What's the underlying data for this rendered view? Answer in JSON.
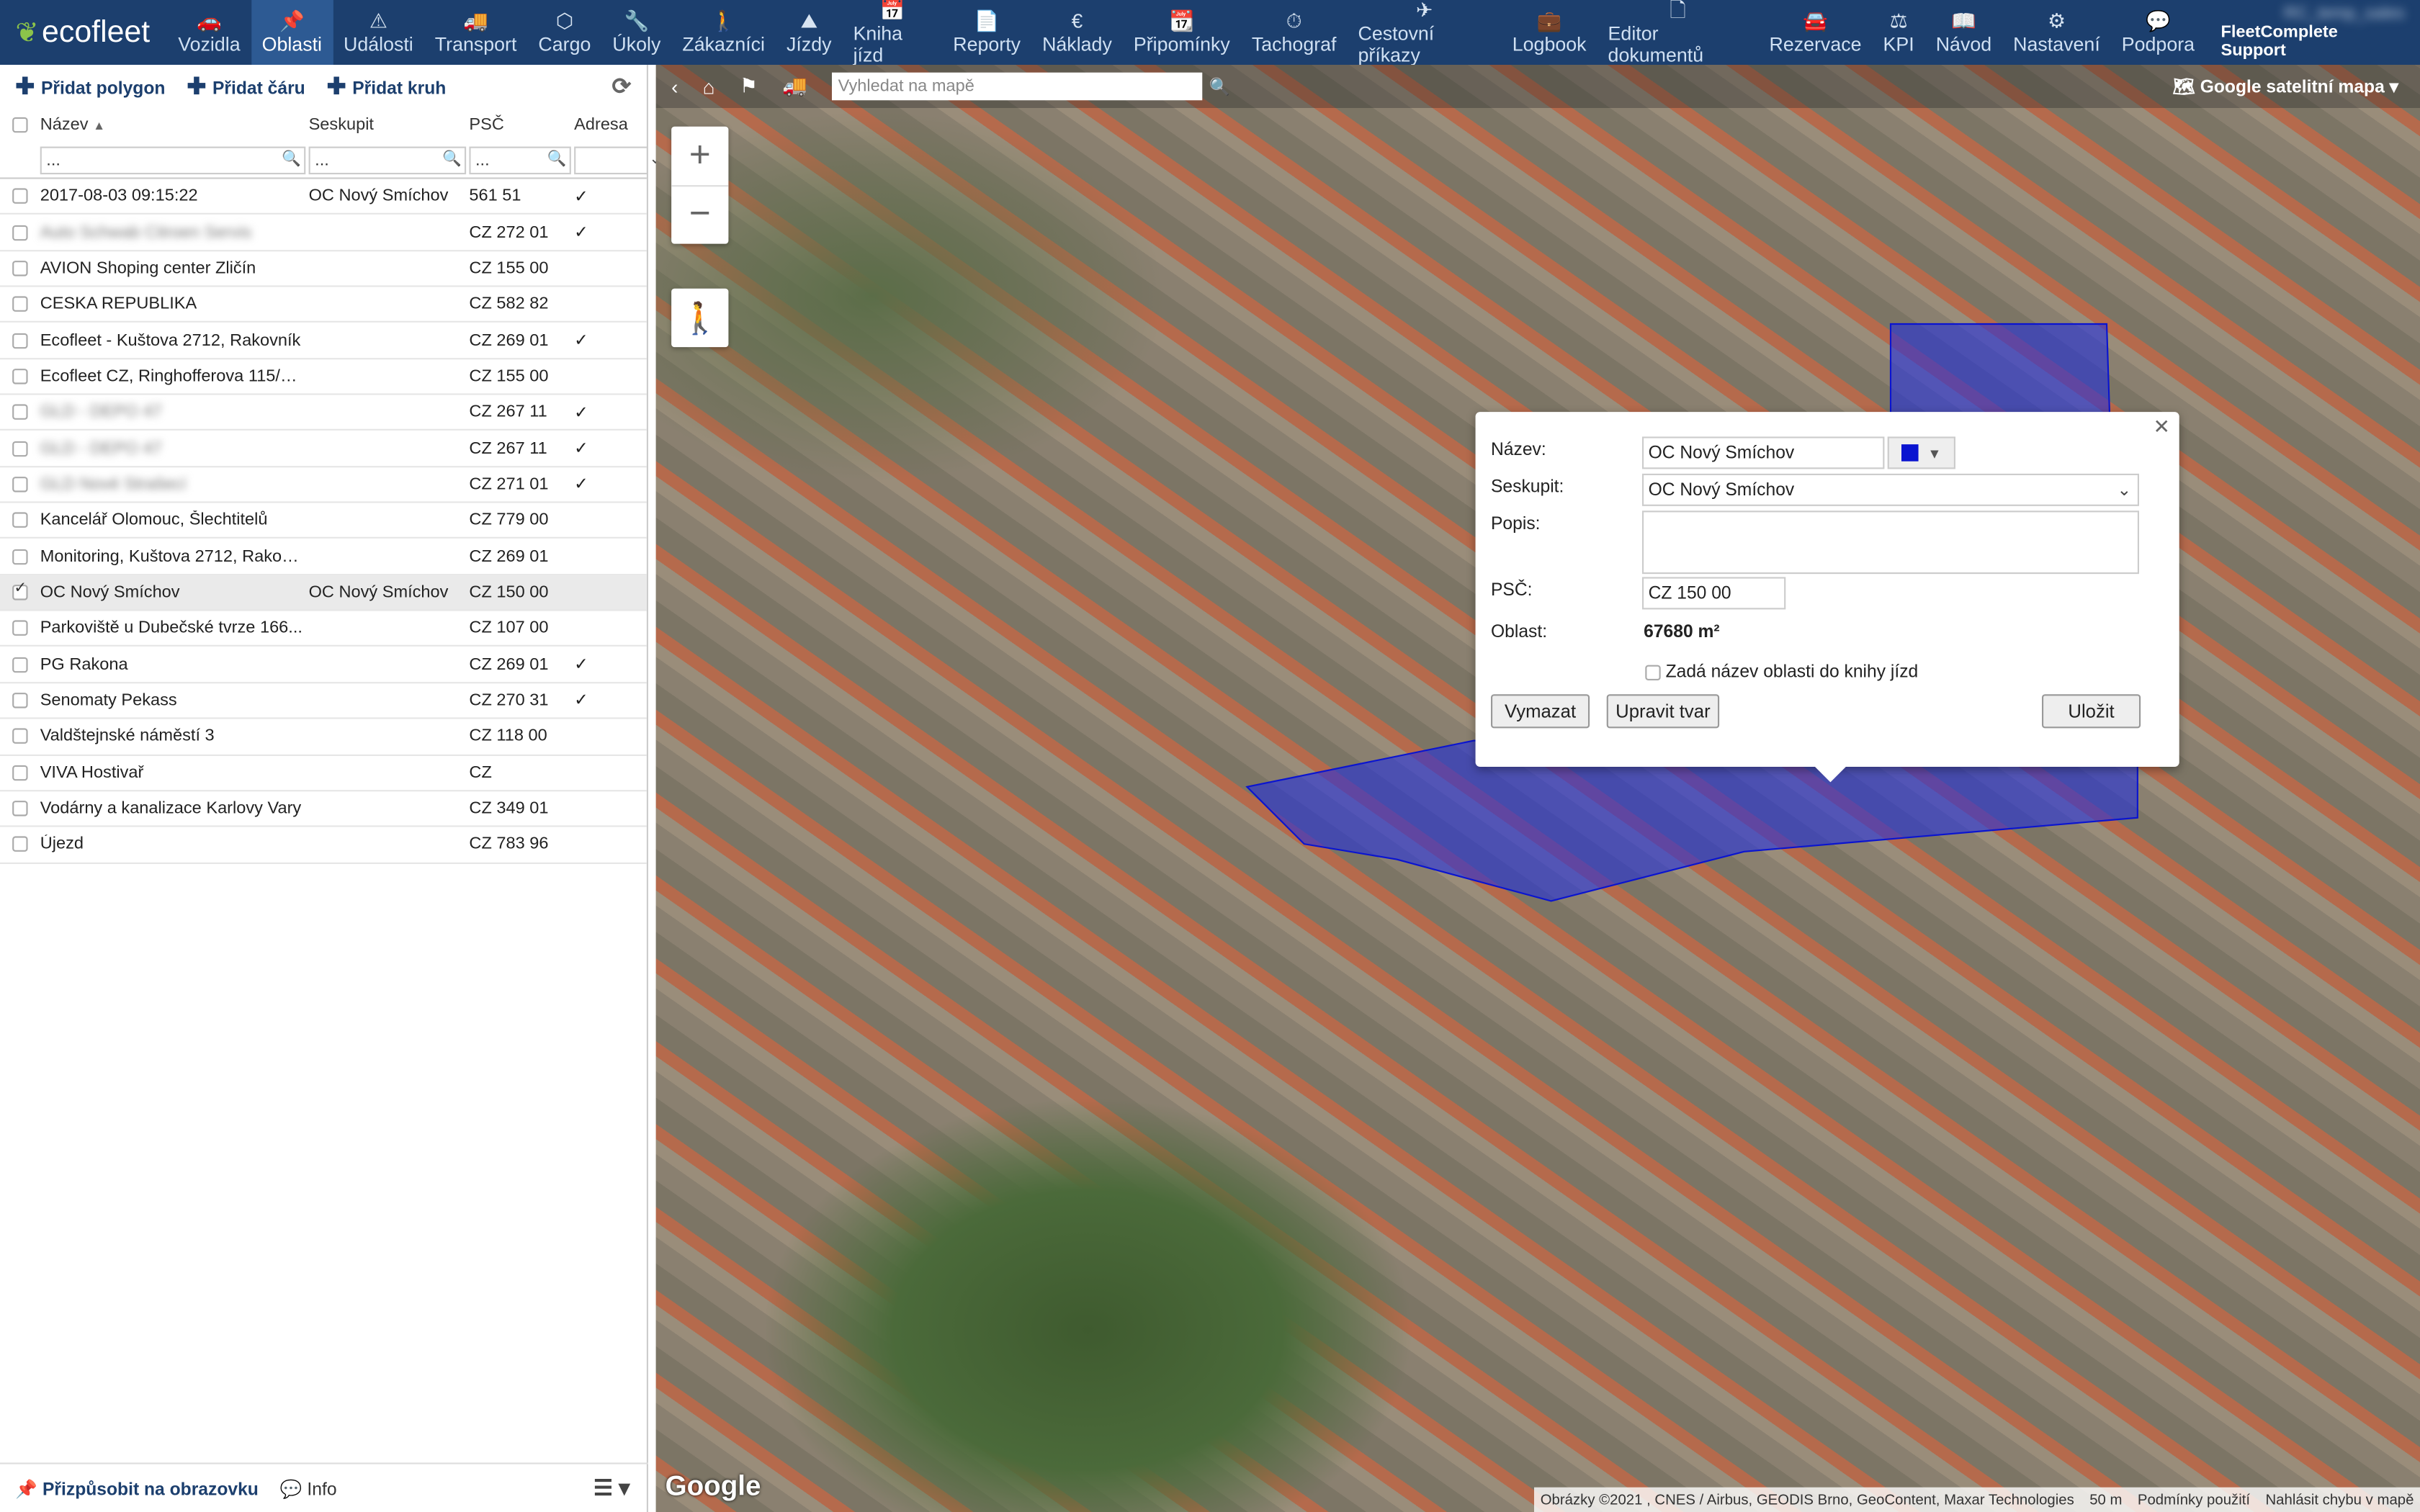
{
  "nav": {
    "brand": "ecofleet",
    "items": [
      {
        "icon": "car-icon",
        "glyph": "🚗",
        "label": "Vozidla"
      },
      {
        "icon": "pin-icon",
        "glyph": "📌",
        "label": "Oblasti"
      },
      {
        "icon": "warning-icon",
        "glyph": "⚠",
        "label": "Události"
      },
      {
        "icon": "truck-icon",
        "glyph": "🚚",
        "label": "Transport"
      },
      {
        "icon": "box-icon",
        "glyph": "⬡",
        "label": "Cargo"
      },
      {
        "icon": "wrench-icon",
        "glyph": "🔧",
        "label": "Úkoly"
      },
      {
        "icon": "person-icon",
        "glyph": "🚶",
        "label": "Zákazníci"
      },
      {
        "icon": "road-icon",
        "glyph": "⛰",
        "label": "Jízdy"
      },
      {
        "icon": "calendar-icon",
        "glyph": "📅",
        "label": "Kniha jízd"
      },
      {
        "icon": "document-icon",
        "glyph": "📄",
        "label": "Reporty"
      },
      {
        "icon": "euro-icon",
        "glyph": "€",
        "label": "Náklady"
      },
      {
        "icon": "calendar-check-icon",
        "glyph": "📆",
        "label": "Připomínky"
      },
      {
        "icon": "gauge-icon",
        "glyph": "⏱",
        "label": "Tachograf"
      },
      {
        "icon": "plane-icon",
        "glyph": "✈",
        "label": "Cestovní příkazy"
      },
      {
        "icon": "briefcase-icon",
        "glyph": "💼",
        "label": "Logbook"
      },
      {
        "icon": "file-icon",
        "glyph": "🗋",
        "label": "Editor dokumentů"
      },
      {
        "icon": "car-front-icon",
        "glyph": "🚘",
        "label": "Rezervace"
      },
      {
        "icon": "scales-icon",
        "glyph": "⚖",
        "label": "KPI"
      }
    ],
    "right_items": [
      {
        "icon": "book-icon",
        "glyph": "📖",
        "label": "Návod"
      },
      {
        "icon": "gears-icon",
        "glyph": "⚙",
        "label": "Nastavení"
      },
      {
        "icon": "chat-icon",
        "glyph": "💬",
        "label": "Podpora"
      }
    ],
    "user_line1": "RC_temp_sales",
    "user_line2": "FleetComplete Support",
    "active_color": "#2d5a93",
    "bar_color": "#1c3f6e"
  },
  "toolbar": {
    "add_polygon": "Přidat polygon",
    "add_line": "Přidat čáru",
    "add_circle": "Přidat kruh"
  },
  "table": {
    "headers": {
      "name": "Název",
      "group": "Seskupit",
      "zip": "PSČ",
      "address": "Adresa"
    },
    "filters": {
      "name": "...",
      "group": "...",
      "zip": "..."
    },
    "rows": [
      {
        "name": "2017-08-03 09:15:22",
        "group": "OC Nový Smíchov",
        "zip": "561 51",
        "addr": "✓",
        "blur": false,
        "checked": false
      },
      {
        "name": "Auto Schwab Citroen Servis",
        "group": "",
        "zip": "CZ 272 01",
        "addr": "✓",
        "blur": true,
        "checked": false
      },
      {
        "name": "AVION Shoping center Zličín",
        "group": "",
        "zip": "CZ 155 00",
        "addr": "",
        "blur": false,
        "checked": false
      },
      {
        "name": "CESKA REPUBLIKA",
        "group": "",
        "zip": "CZ 582 82",
        "addr": "",
        "blur": false,
        "checked": false
      },
      {
        "name": "Ecofleet - Kuštova 2712, Rakovník",
        "group": "",
        "zip": "CZ 269 01",
        "addr": "✓",
        "blur": false,
        "checked": false
      },
      {
        "name": "Ecofleet CZ, Ringhofferova 115/1,...",
        "group": "",
        "zip": "CZ 155 00",
        "addr": "",
        "blur": false,
        "checked": false
      },
      {
        "name": "GLD - DEPO 47",
        "group": "",
        "zip": "CZ 267 11",
        "addr": "✓",
        "blur": true,
        "checked": false
      },
      {
        "name": "GLD - DEPO 47",
        "group": "",
        "zip": "CZ 267 11",
        "addr": "✓",
        "blur": true,
        "checked": false
      },
      {
        "name": "GLD Nové Strašecí",
        "group": "",
        "zip": "CZ 271 01",
        "addr": "✓",
        "blur": true,
        "checked": false
      },
      {
        "name": "Kancelář Olomouc, Šlechtitelů",
        "group": "",
        "zip": "CZ 779 00",
        "addr": "",
        "blur": false,
        "checked": false
      },
      {
        "name": "Monitoring, Kuštova 2712, Rakovník",
        "group": "",
        "zip": "CZ 269 01",
        "addr": "",
        "blur": false,
        "checked": false
      },
      {
        "name": "OC Nový Smíchov",
        "group": "OC Nový Smíchov",
        "zip": "CZ 150 00",
        "addr": "",
        "blur": false,
        "checked": true
      },
      {
        "name": "Parkoviště u Dubečské tvrze 166...",
        "group": "",
        "zip": "CZ 107 00",
        "addr": "",
        "blur": false,
        "checked": false
      },
      {
        "name": "PG Rakona",
        "group": "",
        "zip": "CZ 269 01",
        "addr": "✓",
        "blur": false,
        "checked": false
      },
      {
        "name": "Senomaty Pekass",
        "group": "",
        "zip": "CZ 270 31",
        "addr": "✓",
        "blur": false,
        "checked": false
      },
      {
        "name": "Valdštejnské náměstí 3",
        "group": "",
        "zip": "CZ 118 00",
        "addr": "",
        "blur": false,
        "checked": false
      },
      {
        "name": "VIVA Hostivař",
        "group": "",
        "zip": "CZ",
        "addr": "",
        "blur": false,
        "checked": false
      },
      {
        "name": "Vodárny a kanalizace Karlovy Vary",
        "group": "",
        "zip": "CZ 349 01",
        "addr": "",
        "blur": false,
        "checked": false
      },
      {
        "name": "Újezd",
        "group": "",
        "zip": "CZ 783 96",
        "addr": "",
        "blur": false,
        "checked": false
      }
    ]
  },
  "footer": {
    "fit_label": "Přizpůsobit na obrazovku",
    "info_label": "Info"
  },
  "map": {
    "search_placeholder": "Vyhledat na mapě",
    "map_type": "Google satelitní mapa",
    "google_logo": "Google",
    "attribution": "Obrázky ©2021 , CNES / Airbus, GEODIS Brno, GeoContent, Maxar Technologies",
    "scale": "50 m",
    "terms": "Podmínky použití",
    "report": "Nahlásit chybu v mapě",
    "polygon_color": "#0a14d0"
  },
  "popup": {
    "name_label": "Název:",
    "name_value": "OC Nový Smíchov",
    "group_label": "Seskupit:",
    "group_value": "OC Nový Smíchov",
    "desc_label": "Popis:",
    "desc_value": "",
    "zip_label": "PSČ:",
    "zip_value": "CZ 150 00",
    "area_label": "Oblast:",
    "area_value": "67680 m²",
    "checkbox_label": "Zadá název oblasti do knihy jízd",
    "delete_button": "Vymazat",
    "edit_shape_button": "Upravit tvar",
    "save_button": "Uložit"
  }
}
